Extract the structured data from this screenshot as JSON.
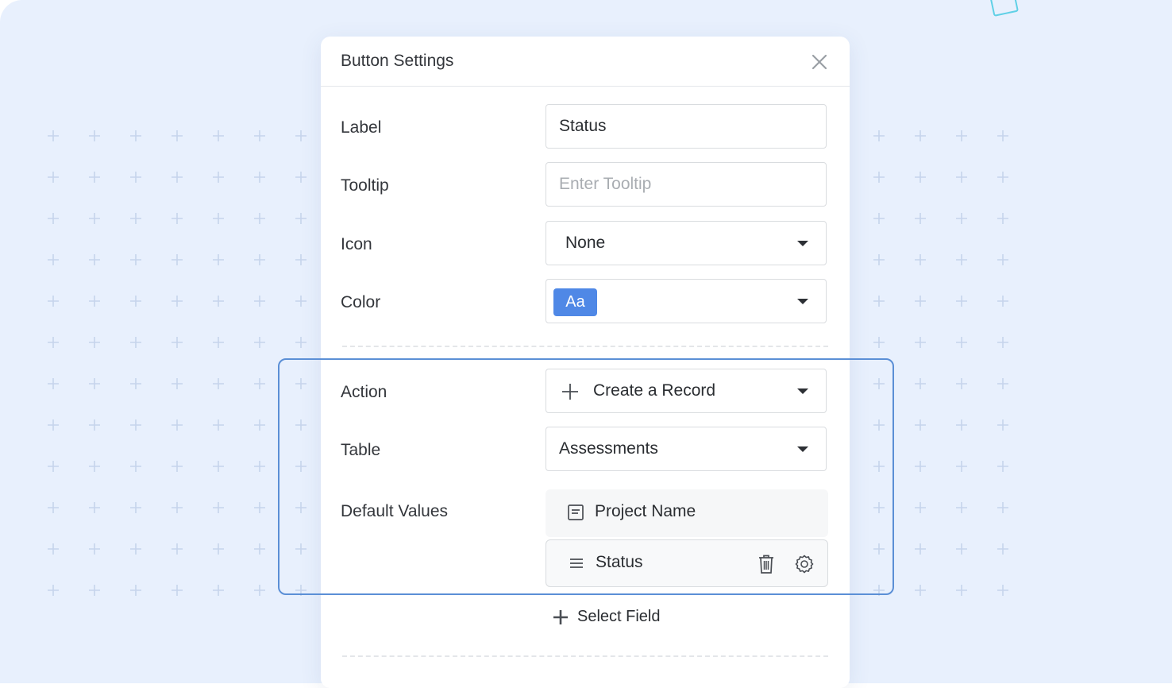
{
  "dialog": {
    "title": "Button Settings"
  },
  "form": {
    "label": {
      "caption": "Label",
      "value": "Status"
    },
    "tooltip": {
      "caption": "Tooltip",
      "placeholder": "Enter Tooltip",
      "value": ""
    },
    "icon": {
      "caption": "Icon",
      "value": "None"
    },
    "color": {
      "caption": "Color",
      "chip_text": "Aa",
      "chip_color": "#4f88e6"
    },
    "action": {
      "caption": "Action",
      "value": "Create a Record",
      "icon": "plus-icon"
    },
    "table": {
      "caption": "Table",
      "value": "Assessments"
    },
    "default_values": {
      "caption": "Default Values",
      "items": [
        {
          "label": "Project Name",
          "icon": "text-field-icon"
        },
        {
          "label": "Status",
          "icon": "list-lines-icon"
        }
      ]
    },
    "select_field_label": "Select Field"
  },
  "colors": {
    "background": "#e8f0fd",
    "highlight_border": "#5b8fd6",
    "accent": "#4f88e6"
  }
}
